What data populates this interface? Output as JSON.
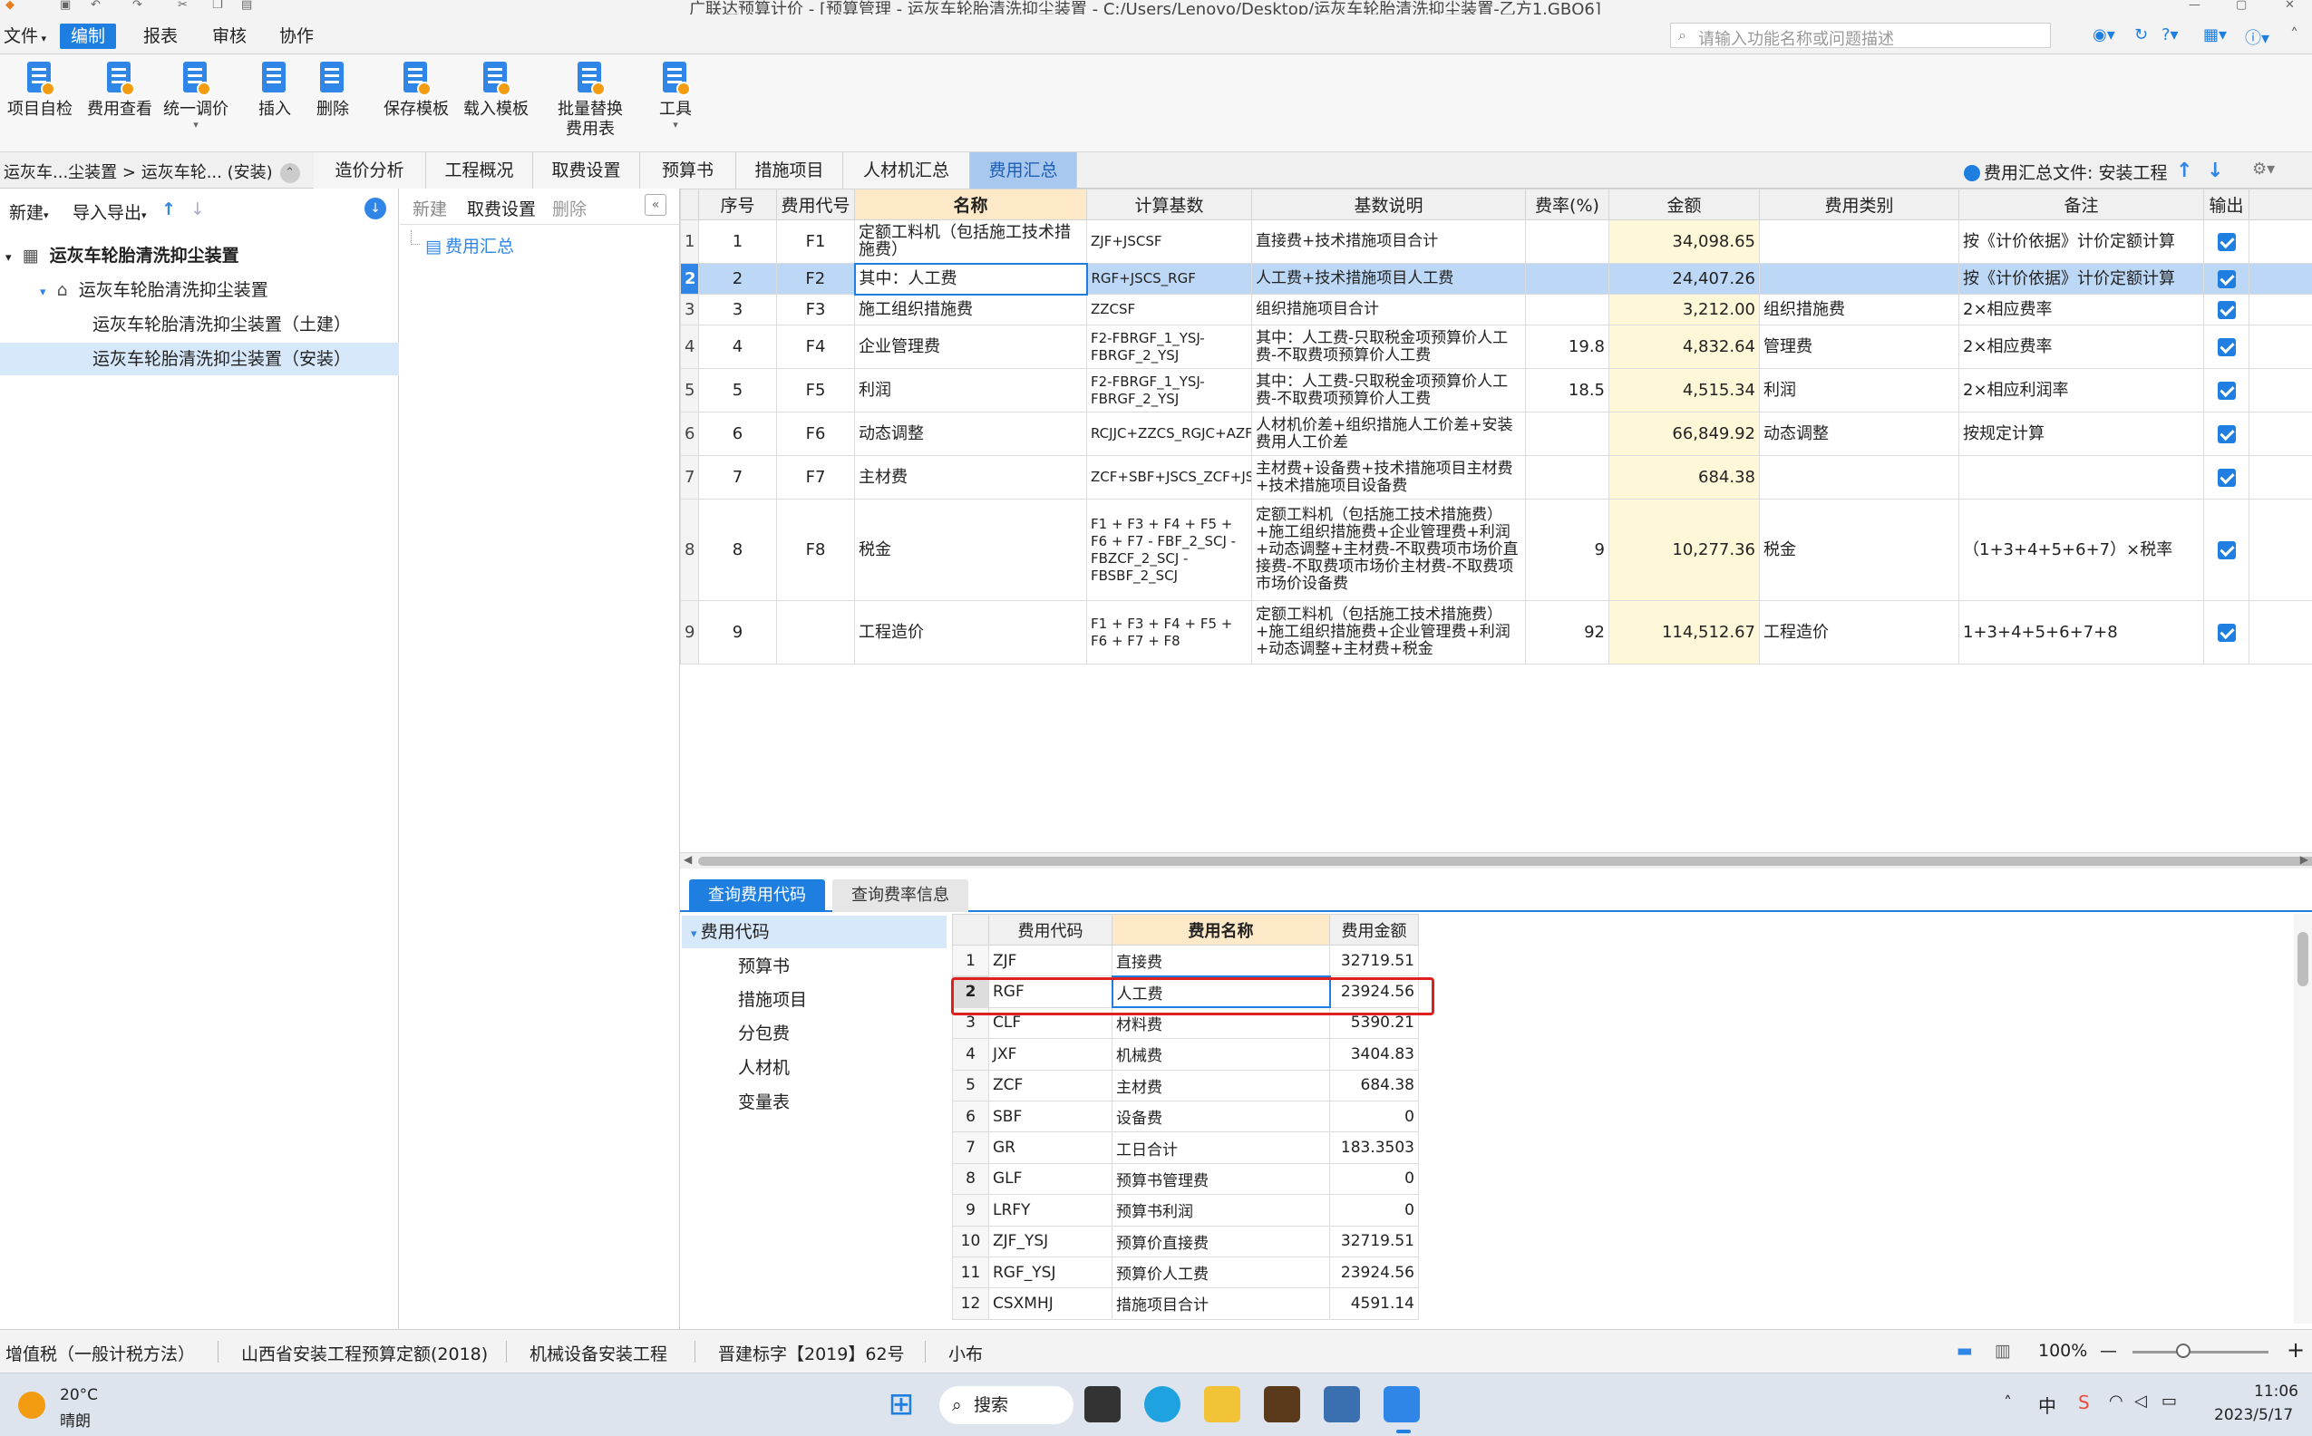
{
  "title": {
    "text": "广联达预算计价 - [预算管理 - 运灰车轮胎清洗抑尘装置 - C:/Users/Lenovo/Desktop/运灰车轮胎清洗抑尘装置-乙方1.GBQ6]"
  },
  "menu": {
    "items": [
      "文件",
      "编制",
      "报表",
      "审核",
      "协作"
    ],
    "search_placeholder": "请输入功能名称或问题描述"
  },
  "toolbar": {
    "items": [
      "项目自检",
      "费用查看",
      "统一调价",
      "插入",
      "删除",
      "保存模板",
      "载入模板",
      "批量替换",
      "费用表",
      "工具"
    ]
  },
  "nav": {
    "breadcrumb": "运灰车...尘装置 > 运灰车轮... (安装)",
    "tabs": [
      "造价分析",
      "工程概况",
      "取费设置",
      "预算书",
      "措施项目",
      "人材机汇总",
      "费用汇总"
    ],
    "active_tab": "费用汇总",
    "summary_file": "费用汇总文件: 安装工程"
  },
  "left": {
    "new_label": "新建",
    "import_label": "导入导出",
    "tree": [
      "运灰车轮胎清洗抑尘装置",
      "运灰车轮胎清洗抑尘装置",
      "运灰车轮胎清洗抑尘装置（土建）",
      "运灰车轮胎清洗抑尘装置（安装）"
    ]
  },
  "mid": {
    "new": "新建",
    "fee_setting": "取费设置",
    "delete": "删除",
    "item": "费用汇总"
  },
  "main_table": {
    "headers": [
      "序号",
      "费用代号",
      "名称",
      "计算基数",
      "基数说明",
      "费率(%)",
      "金额",
      "费用类别",
      "备注",
      "输出"
    ],
    "rows": [
      {
        "rn": "1",
        "seq": "1",
        "code": "F1",
        "name": "定额工料机（包括施工技术措施费）",
        "base": "ZJF+JSCSF",
        "desc": "直接费+技术措施项目合计",
        "rate": "",
        "amount": "34,098.65",
        "cat": "",
        "note": "按《计价依据》计价定额计算"
      },
      {
        "rn": "2",
        "seq": "2",
        "code": "F2",
        "name": "其中：人工费",
        "base": "RGF+JSCS_RGF",
        "desc": "人工费+技术措施项目人工费",
        "rate": "",
        "amount": "24,407.26",
        "cat": "",
        "note": "按《计价依据》计价定额计算"
      },
      {
        "rn": "3",
        "seq": "3",
        "code": "F3",
        "name": "施工组织措施费",
        "base": "ZZCSF",
        "desc": "组织措施项目合计",
        "rate": "",
        "amount": "3,212.00",
        "cat": "组织措施费",
        "note": "2×相应费率"
      },
      {
        "rn": "4",
        "seq": "4",
        "code": "F4",
        "name": "企业管理费",
        "base": "F2-FBRGF_1_YSJ-FBRGF_2_YSJ",
        "desc": "其中：人工费-只取税金项预算价人工费-不取费项预算价人工费",
        "rate": "19.8",
        "amount": "4,832.64",
        "cat": "管理费",
        "note": "2×相应费率"
      },
      {
        "rn": "5",
        "seq": "5",
        "code": "F5",
        "name": "利润",
        "base": "F2-FBRGF_1_YSJ-FBRGF_2_YSJ",
        "desc": "其中：人工费-只取税金项预算价人工费-不取费项预算价人工费",
        "rate": "18.5",
        "amount": "4,515.34",
        "cat": "利润",
        "note": "2×相应利润率"
      },
      {
        "rn": "6",
        "seq": "6",
        "code": "F6",
        "name": "动态调整",
        "base": "RCJJC+ZZCS_RGJC+AZFY_RGJC",
        "desc": "人材机价差+组织措施人工价差+安装费用人工价差",
        "rate": "",
        "amount": "66,849.92",
        "cat": "动态调整",
        "note": "按规定计算"
      },
      {
        "rn": "7",
        "seq": "7",
        "code": "F7",
        "name": "主材费",
        "base": "ZCF+SBF+JSCS_ZCF+JSCS_SBF",
        "desc": "主材费+设备费+技术措施项目主材费+技术措施项目设备费",
        "rate": "",
        "amount": "684.38",
        "cat": "",
        "note": ""
      },
      {
        "rn": "8",
        "seq": "8",
        "code": "F8",
        "name": "税金",
        "base": "F1 + F3 + F4 + F5 + F6 + F7 - FBF_2_SCJ - FBZCF_2_SCJ - FBSBF_2_SCJ",
        "desc": "定额工料机（包括施工技术措施费）+施工组织措施费+企业管理费+利润+动态调整+主材费-不取费项市场价直接费-不取费项市场价主材费-不取费项市场价设备费",
        "rate": "9",
        "amount": "10,277.36",
        "cat": "税金",
        "note": "（1+3+4+5+6+7）×税率"
      },
      {
        "rn": "9",
        "seq": "9",
        "code": "",
        "name": "工程造价",
        "base": "F1 + F3 + F4 + F5 + F6 + F7 + F8",
        "desc": "定额工料机（包括施工技术措施费）+施工组织措施费+企业管理费+利润+动态调整+主材费+税金",
        "rate": "92",
        "amount": "114,512.67",
        "cat": "工程造价",
        "note": "1+3+4+5+6+7+8"
      }
    ]
  },
  "bottom": {
    "tabs": [
      "查询费用代码",
      "查询费率信息"
    ],
    "tree": [
      "费用代码",
      "预算书",
      "措施项目",
      "分包费",
      "人材机",
      "变量表"
    ],
    "headers": [
      "费用代码",
      "费用名称",
      "费用金额"
    ],
    "rows": [
      {
        "rn": "1",
        "code": "ZJF",
        "name": "直接费",
        "amount": "32719.51"
      },
      {
        "rn": "2",
        "code": "RGF",
        "name": "人工费",
        "amount": "23924.56"
      },
      {
        "rn": "3",
        "code": "CLF",
        "name": "材料费",
        "amount": "5390.21"
      },
      {
        "rn": "4",
        "code": "JXF",
        "name": "机械费",
        "amount": "3404.83"
      },
      {
        "rn": "5",
        "code": "ZCF",
        "name": "主材费",
        "amount": "684.38"
      },
      {
        "rn": "6",
        "code": "SBF",
        "name": "设备费",
        "amount": "0"
      },
      {
        "rn": "7",
        "code": "GR",
        "name": "工日合计",
        "amount": "183.3503"
      },
      {
        "rn": "8",
        "code": "GLF",
        "name": "预算书管理费",
        "amount": "0"
      },
      {
        "rn": "9",
        "code": "LRFY",
        "name": "预算书利润",
        "amount": "0"
      },
      {
        "rn": "10",
        "code": "ZJF_YSJ",
        "name": "预算价直接费",
        "amount": "32719.51"
      },
      {
        "rn": "11",
        "code": "RGF_YSJ",
        "name": "预算价人工费",
        "amount": "23924.56"
      },
      {
        "rn": "12",
        "code": "CSXMHJ",
        "name": "措施项目合计",
        "amount": "4591.14"
      }
    ]
  },
  "status": {
    "items": [
      "增值税（一般计税方法）",
      "山西省安装工程预算定额(2018)",
      "机械设备安装工程",
      "晋建标字【2019】62号",
      "小布"
    ],
    "zoom": "100%"
  },
  "taskbar": {
    "weather_temp": "20°C",
    "weather_desc": "晴朗",
    "search": "搜索",
    "ime": "中",
    "time": "11:06",
    "date": "2023/5/17"
  },
  "colors": {
    "accent": "#1f7fe0",
    "selected_row": "#bcd8f6",
    "amount_bg": "#fff8d8",
    "highlight_border": "#e02020"
  }
}
